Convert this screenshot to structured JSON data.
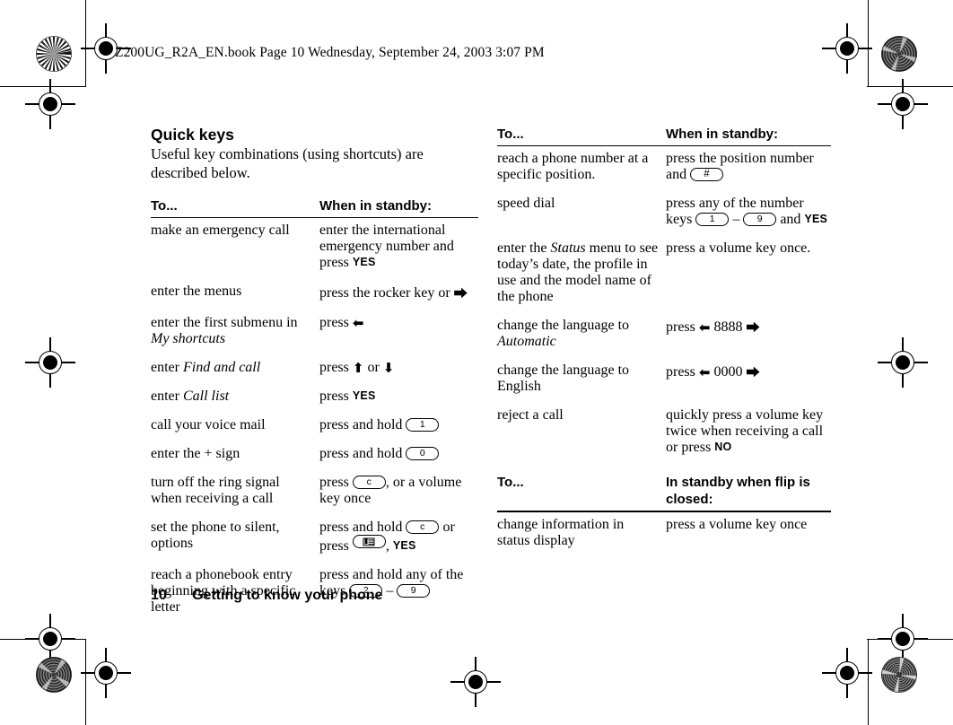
{
  "file_header": "Z200UG_R2A_EN.book  Page 10  Wednesday, September 24, 2003  3:07 PM",
  "section": {
    "heading": "Quick keys",
    "lead": "Useful key combinations (using shortcuts) are described below."
  },
  "footer": {
    "page_number": "10",
    "chapter": "Getting to know your phone"
  },
  "glyphs": {
    "arrow_right": "⮕",
    "arrow_left": "⬅",
    "arrow_up": "⬆",
    "arrow_down": "⬇",
    "dash": "–",
    "yes": "YES",
    "no": "NO"
  },
  "tables": [
    {
      "id": "left-standby",
      "column": "left",
      "headers": [
        "To...",
        "When in standby:"
      ],
      "rows": [
        {
          "to": "make an emergency call",
          "action": "enter the international emergency number and press <span class=\"sc\">YES</span>"
        },
        {
          "to": "enter the menus",
          "action": "press the rocker key or <span class=\"arr\">⮕</span>"
        },
        {
          "to": "enter the first submenu in <i class=\"it\">My shortcuts</i>",
          "action": "press <span class=\"arr\">⬅</span>"
        },
        {
          "to": "enter <i class=\"it\">Find and call</i>",
          "action": "press <span class=\"arr\">⬆</span> or <span class=\"arr\">⬇</span>"
        },
        {
          "to": "enter <i class=\"it\">Call list</i>",
          "action": "press <span class=\"sc\">YES</span>"
        },
        {
          "to": "call your voice mail",
          "action": "press and hold <span class=\"kc\">1</span>"
        },
        {
          "to": "enter the + sign",
          "action": "press and hold <span class=\"kc\">0</span>"
        },
        {
          "to": "turn off the ring signal when receiving a call",
          "action": "press <span class=\"kc\">c</span>, or a volume key once"
        },
        {
          "to": "set the phone to silent, options",
          "action": "press and hold <span class=\"kc\">c</span> or press <span class=\"kc kc-menu\"><span class=\"mi\"></span></span>, <span class=\"sc\">YES</span>"
        },
        {
          "to": "reach a phonebook entry beginning with a specific letter",
          "action": "press and hold any of the keys <span class=\"kc\">2</span> – <span class=\"kc\">9</span>"
        }
      ]
    },
    {
      "id": "right-standby",
      "column": "right",
      "headers": [
        "To...",
        "When in standby:"
      ],
      "rows": [
        {
          "to": "reach a phone number at a specific position.",
          "action": "press the position number and <span class=\"kc hash\">#</span>"
        },
        {
          "to": "speed dial",
          "action": "press any of the number keys <span class=\"kc\">1</span> – <span class=\"kc\">9</span> and <span class=\"sc\">YES</span>"
        },
        {
          "to": "enter the <i class=\"it\">Status</i> menu to see today’s date, the profile in use and the model name of the phone",
          "action": "press a volume key once."
        },
        {
          "to": "change the language to <i class=\"it\">Automatic</i>",
          "action": "press <span class=\"arr\">⬅</span> 8888 <span class=\"arr\">⮕</span>"
        },
        {
          "to": "change the language to English",
          "action": "press <span class=\"arr\">⬅</span> 0000 <span class=\"arr\">⮕</span>"
        },
        {
          "to": "reject a call",
          "action": "quickly press a volume key twice when receiving a call or press <span class=\"sc\">NO</span>"
        }
      ]
    },
    {
      "id": "right-flip-closed",
      "column": "right",
      "headers": [
        "To...",
        "In standby when flip is closed:"
      ],
      "rows": [
        {
          "to": "change information in status display",
          "action": "press a volume key once"
        }
      ]
    }
  ]
}
